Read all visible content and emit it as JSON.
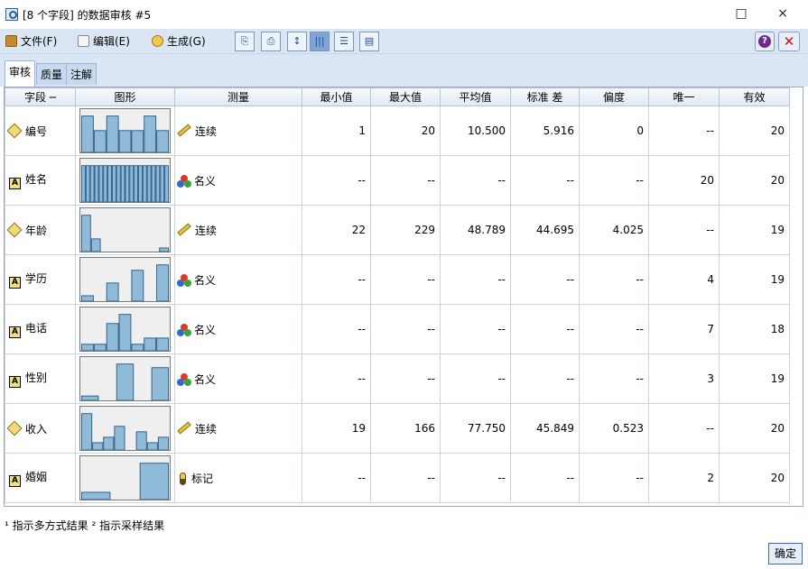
{
  "window": {
    "title": "[8 个字段] 的数据审核 #5",
    "minimize": "□",
    "close": "×"
  },
  "menu": [
    {
      "label": "文件(F)",
      "icon": "folder-icon"
    },
    {
      "label": "编辑(E)",
      "icon": "document-icon"
    },
    {
      "label": "生成(G)",
      "icon": "generate-icon"
    }
  ],
  "toolbar_buttons": [
    {
      "name": "copy-graph-button",
      "glyph": "⎘"
    },
    {
      "name": "print-button",
      "glyph": "⎙"
    },
    {
      "name": "sort-button",
      "glyph": "↕"
    },
    {
      "name": "grid-view-button",
      "glyph": "|||"
    },
    {
      "name": "list-view-button",
      "glyph": "☰"
    },
    {
      "name": "export-button",
      "glyph": "▤"
    }
  ],
  "help_label": "?",
  "close_label": "✕",
  "tabs": [
    {
      "label": "审核",
      "active": true
    },
    {
      "label": "质量",
      "active": false
    },
    {
      "label": "注解",
      "active": false
    }
  ],
  "columns": [
    "字段 ─",
    "图形",
    "测量",
    "最小值",
    "最大值",
    "平均值",
    "标准 差",
    "偏度",
    "唯一",
    "有效"
  ],
  "rows": [
    {
      "field": "编号",
      "type": "continuous",
      "measure": "连续",
      "measure_icon": "ruler-icon",
      "min": "1",
      "max": "20",
      "mean": "10.500",
      "std": "5.916",
      "skew": "0",
      "unique": "--",
      "valid": "20",
      "bars": [
        1.0,
        0.6,
        1.0,
        0.6,
        0.6,
        1.0,
        0.6
      ]
    },
    {
      "field": "姓名",
      "type": "string",
      "measure": "名义",
      "measure_icon": "nominal-icon",
      "min": "--",
      "max": "--",
      "mean": "--",
      "std": "--",
      "skew": "--",
      "unique": "20",
      "valid": "20",
      "bars": [
        1,
        1,
        1,
        1,
        1,
        1,
        1,
        1,
        1,
        1,
        1,
        1,
        1,
        1,
        1,
        1,
        1,
        1,
        1,
        1
      ]
    },
    {
      "field": "年龄",
      "type": "continuous",
      "measure": "连续",
      "measure_icon": "ruler-icon",
      "min": "22",
      "max": "229",
      "mean": "48.789",
      "std": "44.695",
      "skew": "4.025",
      "unique": "--",
      "valid": "19",
      "bars": [
        1.0,
        0.35,
        0,
        0,
        0,
        0,
        0,
        0,
        0.1
      ]
    },
    {
      "field": "学历",
      "type": "string",
      "measure": "名义",
      "measure_icon": "nominal-icon",
      "min": "--",
      "max": "--",
      "mean": "--",
      "std": "--",
      "skew": "--",
      "unique": "4",
      "valid": "19",
      "bars": [
        0.15,
        0,
        0.5,
        0,
        0.85,
        0,
        1.0
      ]
    },
    {
      "field": "电话",
      "type": "string",
      "measure": "名义",
      "measure_icon": "nominal-icon",
      "min": "--",
      "max": "--",
      "mean": "--",
      "std": "--",
      "skew": "--",
      "unique": "7",
      "valid": "18",
      "bars": [
        0.18,
        0.18,
        0.75,
        1.0,
        0.18,
        0.35,
        0.35
      ]
    },
    {
      "field": "性别",
      "type": "string",
      "measure": "名义",
      "measure_icon": "nominal-icon",
      "min": "--",
      "max": "--",
      "mean": "--",
      "std": "--",
      "skew": "--",
      "unique": "3",
      "valid": "19",
      "bars": [
        0.12,
        0,
        1.0,
        0,
        0.9
      ]
    },
    {
      "field": "收入",
      "type": "continuous",
      "measure": "连续",
      "measure_icon": "ruler-icon",
      "min": "19",
      "max": "166",
      "mean": "77.750",
      "std": "45.849",
      "skew": "0.523",
      "unique": "--",
      "valid": "20",
      "bars": [
        1.0,
        0.2,
        0.35,
        0.65,
        0,
        0.5,
        0.2,
        0.35
      ]
    },
    {
      "field": "婚姻",
      "type": "string",
      "measure": "标记",
      "measure_icon": "flag-icon",
      "min": "--",
      "max": "--",
      "mean": "--",
      "std": "--",
      "skew": "--",
      "unique": "2",
      "valid": "20",
      "bars": [
        0.2,
        0,
        1.0
      ]
    }
  ],
  "footnote": "¹ 指示多方式结果   ² 指示采样结果",
  "ok_label": "确定"
}
